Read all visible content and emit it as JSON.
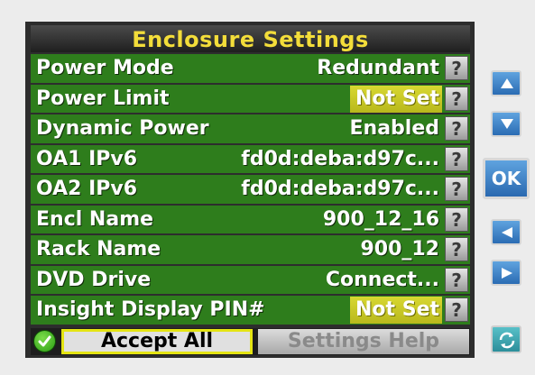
{
  "window": {
    "title": "Enclosure Settings"
  },
  "settings": [
    {
      "label": "Power Mode",
      "value": "Redundant",
      "highlight": false
    },
    {
      "label": "Power Limit",
      "value": "Not Set",
      "highlight": true
    },
    {
      "label": "Dynamic Power",
      "value": "Enabled",
      "highlight": false
    },
    {
      "label": "OA1 IPv6",
      "value": "fd0d:deba:d97c...",
      "highlight": false
    },
    {
      "label": "OA2 IPv6",
      "value": "fd0d:deba:d97c...",
      "highlight": false
    },
    {
      "label": "Encl Name",
      "value": "900_12_16",
      "highlight": false
    },
    {
      "label": "Rack Name",
      "value": "900_12",
      "highlight": false
    },
    {
      "label": "DVD Drive",
      "value": "Connect...",
      "highlight": false
    },
    {
      "label": "Insight Display PIN#",
      "value": "Not Set",
      "highlight": true
    }
  ],
  "help_glyph": "?",
  "footer": {
    "accept_label": "Accept All",
    "help_label": "Settings Help"
  },
  "nav": {
    "ok_label": "OK",
    "icons": [
      "up-arrow-icon",
      "down-arrow-icon",
      "left-arrow-icon",
      "right-arrow-icon",
      "refresh-icon",
      "check-icon"
    ]
  },
  "colors": {
    "row_green": "#2e7d1c",
    "title_yellow": "#f3dd3a",
    "highlight_yellow": "#c8c826",
    "nav_blue": "#3a7fc4"
  }
}
